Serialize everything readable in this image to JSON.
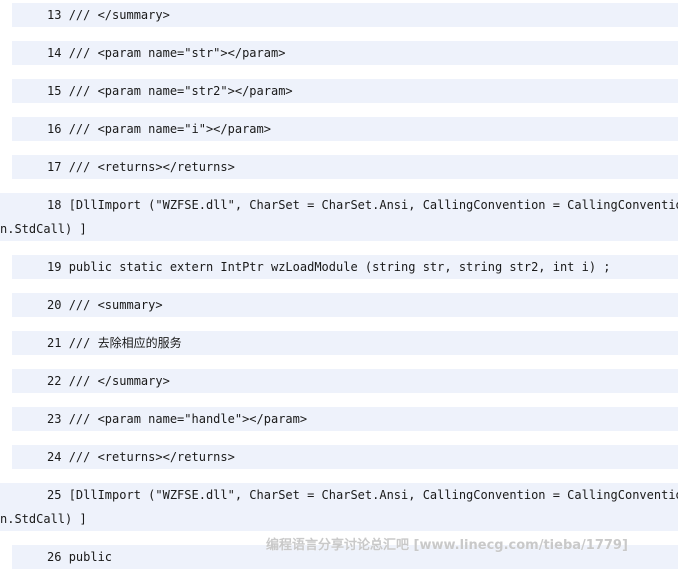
{
  "code_lines": [
    {
      "num": "13",
      "text": "/// </summary>"
    },
    {
      "num": "14",
      "text": "/// <param name=\"str\"></param>"
    },
    {
      "num": "15",
      "text": "/// <param name=\"str2\"></param>"
    },
    {
      "num": "16",
      "text": "/// <param name=\"i\"></param>"
    },
    {
      "num": "17",
      "text": "/// <returns></returns>"
    },
    {
      "num": "18",
      "text": "[DllImport (\"WZFSE.dll\", CharSet = CharSet.Ansi, CallingConvention = CallingConventio",
      "wrap": "n.StdCall) ]"
    },
    {
      "num": "19",
      "text": "public static extern IntPtr wzLoadModule (string str, string str2, int i) ;"
    },
    {
      "num": "20",
      "text": "/// <summary>"
    },
    {
      "num": "21",
      "text": "/// 去除相应的服务"
    },
    {
      "num": "22",
      "text": "/// </summary>"
    },
    {
      "num": "23",
      "text": "/// <param name=\"handle\"></param>"
    },
    {
      "num": "24",
      "text": "/// <returns></returns>"
    },
    {
      "num": "25",
      "text": "[DllImport (\"WZFSE.dll\", CharSet = CharSet.Ansi, CallingConvention = CallingConventio",
      "wrap": "n.StdCall) ]"
    },
    {
      "num": "26",
      "text": "public"
    }
  ],
  "watermark": "编程语言分享讨论总汇吧 [www.linecg.com/tieba/1779]",
  "colors": {
    "line_background": "#eef2fb",
    "text": "#1a1a1a",
    "watermark": "#c9c9c9"
  }
}
